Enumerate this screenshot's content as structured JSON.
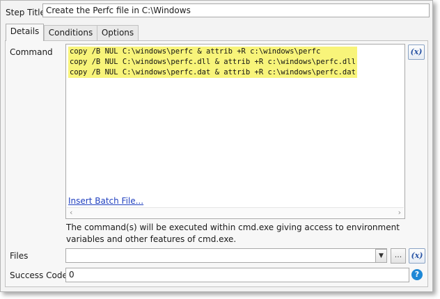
{
  "step_title": {
    "label": "Step Title",
    "value": "Create the Perfc file in C:\\Windows"
  },
  "tabs": [
    {
      "label": "Details",
      "active": true
    },
    {
      "label": "Conditions",
      "active": false
    },
    {
      "label": "Options",
      "active": false
    }
  ],
  "command": {
    "label": "Command",
    "lines": [
      "copy /B NUL C:\\windows\\perfc & attrib +R c:\\windows\\perfc",
      "copy /B NUL C:\\windows\\perfc.dll & attrib +R c:\\windows\\perfc.dll",
      "copy /B NUL C:\\windows\\perfc.dat & attrib +R c:\\windows\\perfc.dat"
    ],
    "highlight_color": "#f8f47a",
    "insert_link": "Insert Batch File...",
    "variable_button": "(x)",
    "help_text": "The command(s) will be executed within cmd.exe giving access to environment variables and other features of cmd.exe."
  },
  "files": {
    "label": "Files",
    "value": "",
    "browse_button": "...",
    "variable_button": "(x)"
  },
  "success_codes": {
    "label": "Success Codes",
    "value": "0",
    "help_icon": "?"
  },
  "colors": {
    "link": "#1f3fbf",
    "variable_accent": "#2a55a5",
    "help_icon": "#1e88d6"
  }
}
